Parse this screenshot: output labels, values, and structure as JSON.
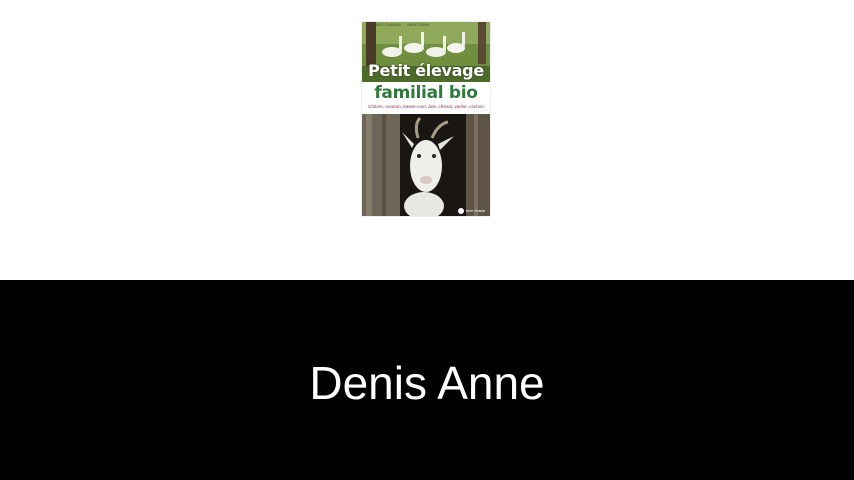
{
  "book": {
    "top_line": "CORNELIS D'AVENY",
    "top_line_publisher": "ANNE DENIS",
    "title_line_1": "Petit élevage",
    "title_line_2": "familial bio",
    "subtitle": "Chèvre, mouton, basse-cour, âne, cheval, vache, cochon",
    "publisher": "terre vivante"
  },
  "author": {
    "name": "Denis Anne"
  },
  "colors": {
    "background": "#ffffff",
    "band": "#000000",
    "author_text": "#ffffff",
    "title_green": "#2f7a3b",
    "subtitle_purple": "#8a2c52"
  }
}
